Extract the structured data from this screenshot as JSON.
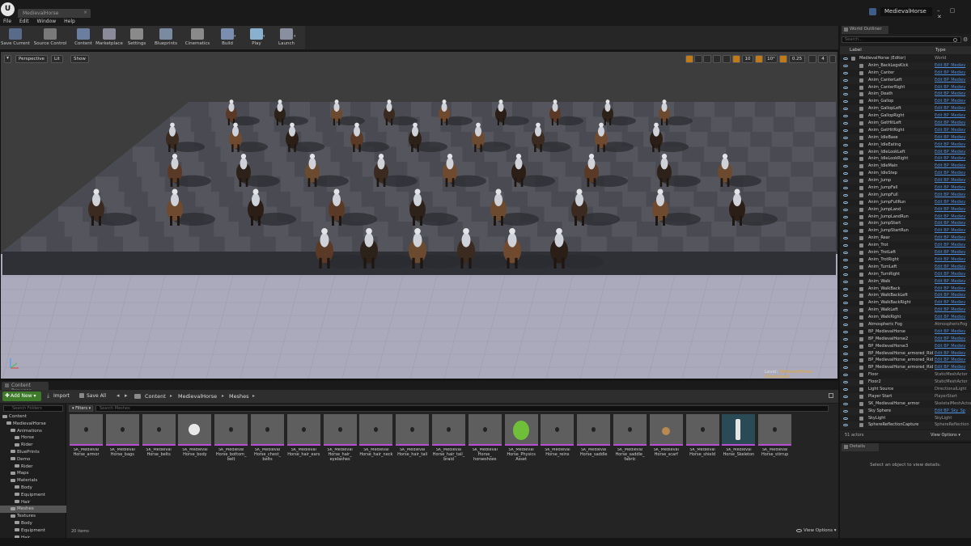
{
  "window": {
    "app_logo": "U",
    "doc_tab": "MedievalHorse",
    "project_name": "MedievalHorse",
    "window_controls": "– ▢ ✕"
  },
  "menu": [
    "File",
    "Edit",
    "Window",
    "Help"
  ],
  "toolbar": [
    {
      "label": "Save Current",
      "icon": "save-icon",
      "color": "#5a6b8a"
    },
    {
      "label": "Source Control",
      "icon": "source-control-icon",
      "color": "#7a7a7a"
    },
    {
      "label": "Content",
      "icon": "content-icon",
      "color": "#6a7fa0"
    },
    {
      "label": "Marketplace",
      "icon": "marketplace-icon",
      "color": "#8a8a9a"
    },
    {
      "label": "Settings",
      "icon": "settings-icon",
      "color": "#8a8a8a"
    },
    {
      "label": "Blueprints",
      "icon": "blueprints-icon",
      "color": "#7a8aa0"
    },
    {
      "label": "Cinematics",
      "icon": "cinematics-icon",
      "color": "#8a8a8a"
    },
    {
      "label": "Build",
      "icon": "build-icon",
      "color": "#7a8fb0"
    },
    {
      "label": "Play",
      "icon": "play-icon",
      "color": "#8ab0d0"
    },
    {
      "label": "Launch",
      "icon": "launch-icon",
      "color": "#8a8fa0"
    }
  ],
  "viewport": {
    "menu_glyph": "▾",
    "perspective_label": "Perspective",
    "lit_label": "Lit",
    "show_label": "Show",
    "grid_snap": "10",
    "rotation_snap": "10°",
    "scale_snap": "0.25",
    "camera_speed": "4",
    "level_prefix": "Level:",
    "level_name": "MedievalHorse (Persistent)"
  },
  "content_browser": {
    "tab": "Content Browser",
    "add_new": "Add New",
    "add_new_glyph": "✚",
    "import": "Import",
    "import_glyph": "⤓",
    "save_all": "Save All",
    "nav_back": "◂",
    "nav_fwd": "▸",
    "crumb_sep": "▸",
    "breadcrumb": [
      "Content",
      "MedievalHorse",
      "Meshes"
    ],
    "folder_search_placeholder": "Search Folders",
    "filters_label": "▾ Filters ▾",
    "asset_search_placeholder": "Search Meshes",
    "folders": [
      {
        "label": "Content",
        "depth": 0
      },
      {
        "label": "MedievalHorse",
        "depth": 1
      },
      {
        "label": "Animations",
        "depth": 2
      },
      {
        "label": "Horse",
        "depth": 3
      },
      {
        "label": "Rider",
        "depth": 3
      },
      {
        "label": "BluePrints",
        "depth": 2
      },
      {
        "label": "Demo",
        "depth": 2
      },
      {
        "label": "Rider",
        "depth": 3
      },
      {
        "label": "Maps",
        "depth": 2
      },
      {
        "label": "Materials",
        "depth": 2
      },
      {
        "label": "Body",
        "depth": 3
      },
      {
        "label": "Equipment",
        "depth": 3
      },
      {
        "label": "Hair",
        "depth": 3
      },
      {
        "label": "Meshes",
        "depth": 2,
        "selected": true
      },
      {
        "label": "Textures",
        "depth": 2
      },
      {
        "label": "Body",
        "depth": 3
      },
      {
        "label": "Equipment",
        "depth": 3
      },
      {
        "label": "Hair",
        "depth": 3
      }
    ],
    "assets": [
      "SK_Medieval Horse_armor",
      "SK_Medieval Horse_bags",
      "SK_Medieval Horse_belts",
      "SK_Medieval Horse_body",
      "SK_Medieval Horse_bottom_ belt",
      "SK_Medieval Horse_chest_ belts",
      "SK_Medieval Horse_hair_ears",
      "SK_Medieval Horse_hair_ eyelashes",
      "SK_Medieval Horse_hair_neck",
      "SK_Medieval Horse_hair_tail",
      "SK_Medieval Horse_hair_tail_ braid",
      "SK_Medieval Horse_ horseshoes",
      "SK_Medieval Horse_Physics Asset",
      "SK_Medieval Horse_reins",
      "SK_Medieval Horse_saddle",
      "SK_Medieval Horse_saddle_ fabric",
      "SK_Medieval Horse_scarf",
      "SK_Medieval Horse_shield",
      "SK_Medieval Horse_Skeleton",
      "SK_Medieval Horse_stirrup"
    ],
    "item_count": "20 items",
    "view_options": "View Options ▾"
  },
  "outliner": {
    "tab": "World Outliner",
    "search_placeholder": "Search...",
    "gear_glyph": "⚙",
    "col_label": "Label",
    "col_type": "Type",
    "rows": [
      {
        "name": "MedievalHorse (Editor)",
        "type": "World",
        "link": false
      },
      {
        "name": "Anim_BackLegsKick",
        "type": "Edit BP_Mediev",
        "link": true
      },
      {
        "name": "Anim_Canter",
        "type": "Edit BP_Mediev",
        "link": true
      },
      {
        "name": "Anim_CanterLeft",
        "type": "Edit BP_Mediev",
        "link": true
      },
      {
        "name": "Anim_CanterRight",
        "type": "Edit BP_Mediev",
        "link": true
      },
      {
        "name": "Anim_Death",
        "type": "Edit BP_Mediev",
        "link": true
      },
      {
        "name": "Anim_Gallop",
        "type": "Edit BP_Mediev",
        "link": true
      },
      {
        "name": "Anim_GallopLeft",
        "type": "Edit BP_Mediev",
        "link": true
      },
      {
        "name": "Anim_GallopRight",
        "type": "Edit BP_Mediev",
        "link": true
      },
      {
        "name": "Anim_GetHitLeft",
        "type": "Edit BP_Mediev",
        "link": true
      },
      {
        "name": "Anim_GetHitRight",
        "type": "Edit BP_Mediev",
        "link": true
      },
      {
        "name": "Anim_IdleBase",
        "type": "Edit BP_Mediev",
        "link": true
      },
      {
        "name": "Anim_IdleEating",
        "type": "Edit BP_Mediev",
        "link": true
      },
      {
        "name": "Anim_IdleLookLeft",
        "type": "Edit BP_Mediev",
        "link": true
      },
      {
        "name": "Anim_IdleLookRight",
        "type": "Edit BP_Mediev",
        "link": true
      },
      {
        "name": "Anim_IdleMain",
        "type": "Edit BP_Mediev",
        "link": true
      },
      {
        "name": "Anim_IdleStep",
        "type": "Edit BP_Mediev",
        "link": true
      },
      {
        "name": "Anim_Jump",
        "type": "Edit BP_Mediev",
        "link": true
      },
      {
        "name": "Anim_JumpFall",
        "type": "Edit BP_Mediev",
        "link": true
      },
      {
        "name": "Anim_JumpFull",
        "type": "Edit BP_Mediev",
        "link": true
      },
      {
        "name": "Anim_JumpFullRun",
        "type": "Edit BP_Mediev",
        "link": true
      },
      {
        "name": "Anim_JumpLand",
        "type": "Edit BP_Mediev",
        "link": true
      },
      {
        "name": "Anim_JumpLandRun",
        "type": "Edit BP_Mediev",
        "link": true
      },
      {
        "name": "Anim_JumpStart",
        "type": "Edit BP_Mediev",
        "link": true
      },
      {
        "name": "Anim_JumpStartRun",
        "type": "Edit BP_Mediev",
        "link": true
      },
      {
        "name": "Anim_Rear",
        "type": "Edit BP_Mediev",
        "link": true
      },
      {
        "name": "Anim_Trot",
        "type": "Edit BP_Mediev",
        "link": true
      },
      {
        "name": "Anim_TrotLeft",
        "type": "Edit BP_Mediev",
        "link": true
      },
      {
        "name": "Anim_TrotRight",
        "type": "Edit BP_Mediev",
        "link": true
      },
      {
        "name": "Anim_TurnLeft",
        "type": "Edit BP_Mediev",
        "link": true
      },
      {
        "name": "Anim_TurnRight",
        "type": "Edit BP_Mediev",
        "link": true
      },
      {
        "name": "Anim_Walk",
        "type": "Edit BP_Mediev",
        "link": true
      },
      {
        "name": "Anim_WalkBack",
        "type": "Edit BP_Mediev",
        "link": true
      },
      {
        "name": "Anim_WalkBackLeft",
        "type": "Edit BP_Mediev",
        "link": true
      },
      {
        "name": "Anim_WalkBackRight",
        "type": "Edit BP_Mediev",
        "link": true
      },
      {
        "name": "Anim_WalkLeft",
        "type": "Edit BP_Mediev",
        "link": true
      },
      {
        "name": "Anim_WalkRight",
        "type": "Edit BP_Mediev",
        "link": true
      },
      {
        "name": "Atmospheric Fog",
        "type": "AtmosphericFog",
        "link": false
      },
      {
        "name": "BP_MedievalHorse",
        "type": "Edit BP_Mediev",
        "link": true
      },
      {
        "name": "BP_MedievalHorse2",
        "type": "Edit BP_Mediev",
        "link": true
      },
      {
        "name": "BP_MedievalHorse3",
        "type": "Edit BP_Mediev",
        "link": true
      },
      {
        "name": "BP_MedievalHorse_armored_Rid",
        "type": "Edit BP_Mediev",
        "link": true
      },
      {
        "name": "BP_MedievalHorse_armored_Rid",
        "type": "Edit BP_Mediev",
        "link": true
      },
      {
        "name": "BP_MedievalHorse_armored_Rid",
        "type": "Edit BP_Mediev",
        "link": true
      },
      {
        "name": "Floor",
        "type": "StaticMeshActor",
        "link": false
      },
      {
        "name": "Floor2",
        "type": "StaticMeshActor",
        "link": false
      },
      {
        "name": "Light Source",
        "type": "DirectionalLight",
        "link": false
      },
      {
        "name": "Player Start",
        "type": "PlayerStart",
        "link": false
      },
      {
        "name": "SK_MedievalHorse_armor",
        "type": "SkeletalMeshActor",
        "link": false
      },
      {
        "name": "Sky Sphere",
        "type": "Edit BP_Sky_Sp",
        "link": true
      },
      {
        "name": "SkyLight",
        "type": "SkyLight",
        "link": false
      },
      {
        "name": "SphereReflectionCapture",
        "type": "SphereReflection",
        "link": false
      }
    ],
    "actor_count": "51 actors",
    "view_options": "View Options ▾"
  },
  "details": {
    "tab": "Details",
    "empty_msg": "Select an object to view details."
  },
  "colors": {
    "accent_green": "#3d7a2a",
    "link_blue": "#4d8fe0",
    "asset_underline": "#b84dd6",
    "level_orange": "#e4a52a"
  }
}
